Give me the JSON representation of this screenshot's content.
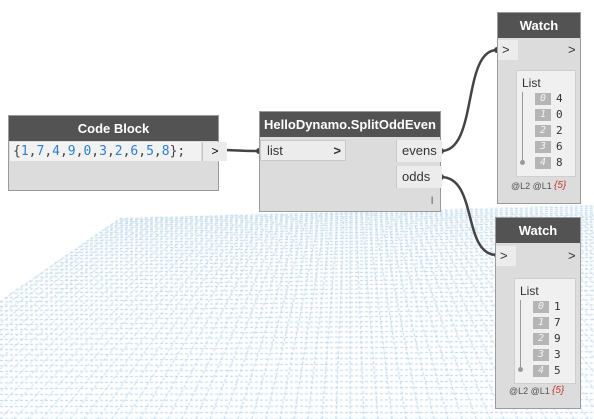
{
  "code_block": {
    "title": "Code Block",
    "tokens": [
      "{",
      "1",
      ",",
      "7",
      ",",
      "4",
      ",",
      "9",
      ",",
      "0",
      ",",
      "3",
      ",",
      "2",
      ",",
      "6",
      ",",
      "5",
      ",",
      "8",
      "};"
    ],
    "output_arrow": ">"
  },
  "split_node": {
    "title": "HelloDynamo.SplitOddEven",
    "input_label": "list",
    "input_arrow": ">",
    "outputs": [
      "evens",
      "odds"
    ],
    "lacing_mark": "l"
  },
  "watch_evens": {
    "title": "Watch",
    "input_arrow": ">",
    "output_arrow": ">",
    "list_title": "List",
    "items": [
      {
        "index": "0",
        "value": "4"
      },
      {
        "index": "1",
        "value": "0"
      },
      {
        "index": "2",
        "value": "2"
      },
      {
        "index": "3",
        "value": "6"
      },
      {
        "index": "4",
        "value": "8"
      }
    ],
    "levels": "@L2 @L1",
    "count": "{5}"
  },
  "watch_odds": {
    "title": "Watch",
    "input_arrow": ">",
    "output_arrow": ">",
    "list_title": "List",
    "items": [
      {
        "index": "0",
        "value": "1"
      },
      {
        "index": "1",
        "value": "7"
      },
      {
        "index": "2",
        "value": "9"
      },
      {
        "index": "3",
        "value": "3"
      },
      {
        "index": "4",
        "value": "5"
      }
    ],
    "levels": "@L2 @L1",
    "count": "{5}"
  },
  "colors": {
    "header": "#535353",
    "node_body": "#dcdcdc",
    "wire": "#444444",
    "number": "#2f7fd1",
    "grid": "#b7d4e8"
  }
}
